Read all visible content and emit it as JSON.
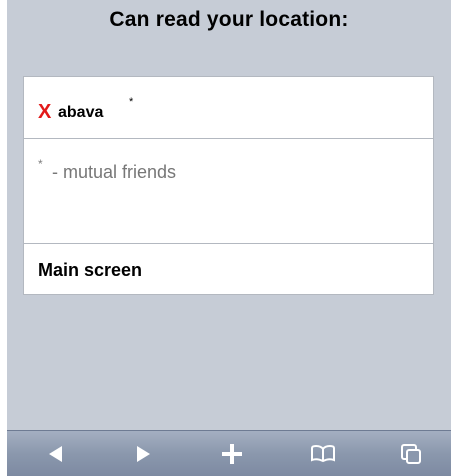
{
  "header": {
    "title": "Can read your location:"
  },
  "friends": [
    {
      "remove_glyph": "X",
      "name": "abava",
      "marker": "*"
    }
  ],
  "legend": {
    "marker": "*",
    "text": "- mutual friends"
  },
  "nav": {
    "main_label": "Main screen"
  },
  "toolbar": {
    "buttons": [
      {
        "icon": "back-arrow-icon"
      },
      {
        "icon": "forward-arrow-icon"
      },
      {
        "icon": "plus-icon"
      },
      {
        "icon": "bookmarks-book-icon"
      },
      {
        "icon": "pages-icon"
      }
    ]
  },
  "colors": {
    "background": "#c6ccd6",
    "remove_accent": "#e21a1a",
    "muted_text": "#777777",
    "toolbar": "#8b98ad"
  }
}
